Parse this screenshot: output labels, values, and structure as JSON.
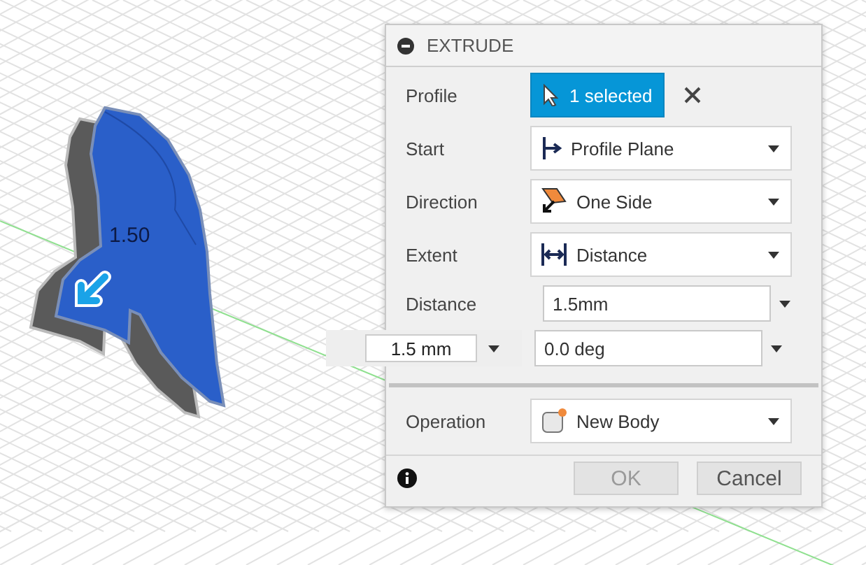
{
  "viewport": {
    "dimension_label": "1.50"
  },
  "floating_input": {
    "value": "1.5 mm"
  },
  "panel": {
    "title": "EXTRUDE",
    "rows": [
      {
        "kind": "selection",
        "label": "Profile",
        "value": "1 selected"
      },
      {
        "kind": "dropdown",
        "label": "Start",
        "value": "Profile Plane"
      },
      {
        "kind": "dropdown",
        "label": "Direction",
        "value": "One Side"
      },
      {
        "kind": "dropdown",
        "label": "Extent",
        "value": "Distance"
      },
      {
        "kind": "input",
        "label": "Distance",
        "value": "1.5mm"
      },
      {
        "kind": "input",
        "value": "0.0 deg"
      },
      {
        "kind": "divider"
      },
      {
        "kind": "dropdown",
        "label": "Operation",
        "value": "New Body"
      }
    ],
    "buttons": [
      {
        "label": "OK",
        "disabled": true
      },
      {
        "label": "Cancel",
        "disabled": false
      }
    ]
  }
}
